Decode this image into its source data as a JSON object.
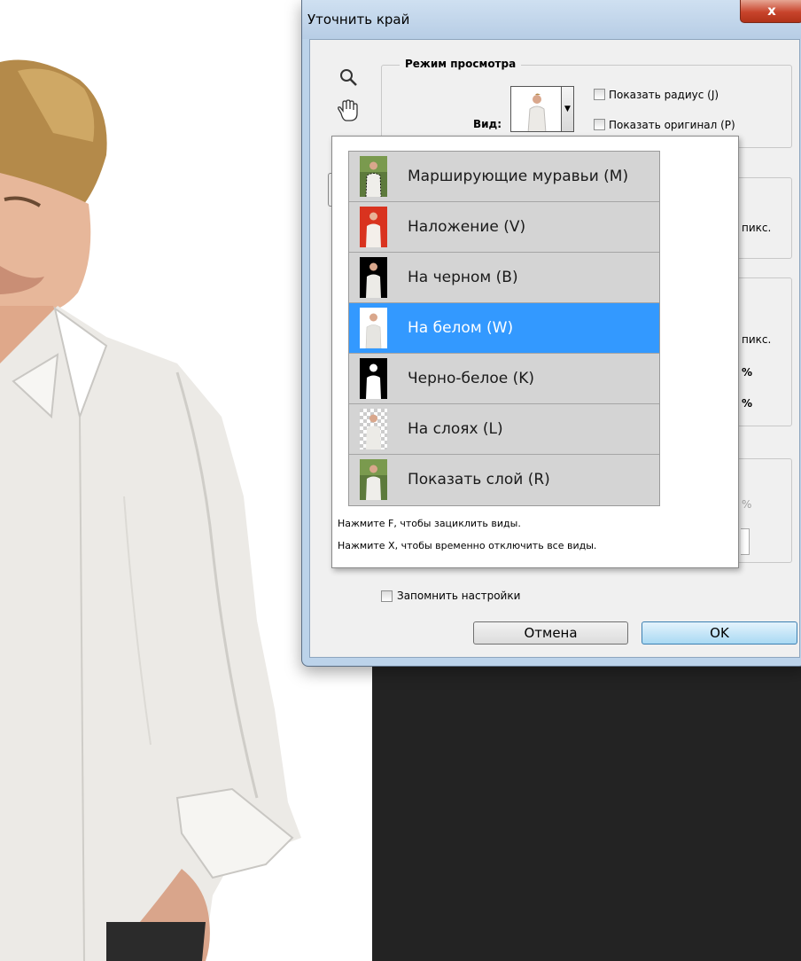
{
  "dialog": {
    "title": "Уточнить край",
    "close_label": "x"
  },
  "view_mode": {
    "group_title": "Режим просмотра",
    "view_label": "Вид:",
    "show_radius_label": "Показать радиус (J)",
    "show_original_label": "Показать оригинал (P)"
  },
  "view_menu": {
    "items": [
      {
        "label": "Марширующие муравьи (M)",
        "thumb": "marching-ants"
      },
      {
        "label": "Наложение (V)",
        "thumb": "overlay"
      },
      {
        "label": "На черном (B)",
        "thumb": "on-black"
      },
      {
        "label": "На белом (W)",
        "thumb": "on-white",
        "selected": true
      },
      {
        "label": "Черно-белое (K)",
        "thumb": "black-white"
      },
      {
        "label": "На слоях (L)",
        "thumb": "on-layers"
      },
      {
        "label": "Показать слой (R)",
        "thumb": "reveal-layer"
      }
    ],
    "hint_cycle": "Нажмите F, чтобы зациклить виды.",
    "hint_disable": "Нажмите X, чтобы временно отключить все виды."
  },
  "units": {
    "px1": "пикс.",
    "px2": "пикс.",
    "pct1": "%",
    "pct2": "%",
    "pct3": "%"
  },
  "footer": {
    "remember_label": "Запомнить настройки",
    "cancel_label": "Отмена",
    "ok_label": "OK"
  },
  "colors": {
    "selected": "#3399ff",
    "canvas": "#232323"
  }
}
